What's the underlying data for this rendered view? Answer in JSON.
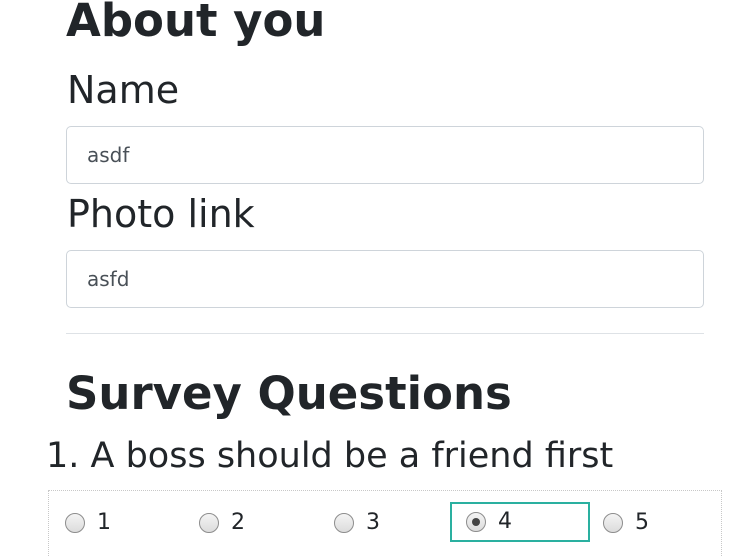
{
  "about": {
    "title": "About you",
    "name_label": "Name",
    "name_value": "asdf",
    "photo_label": "Photo link",
    "photo_value": "asfd"
  },
  "survey": {
    "title": "Survey Questions",
    "question_1": {
      "label": "1. A boss should be a friend first",
      "options": [
        "1",
        "2",
        "3",
        "4",
        "5"
      ],
      "selected": "4"
    }
  },
  "colors": {
    "text": "#212529",
    "focus_border": "#2ab0a0",
    "input_border": "#ced4da"
  }
}
